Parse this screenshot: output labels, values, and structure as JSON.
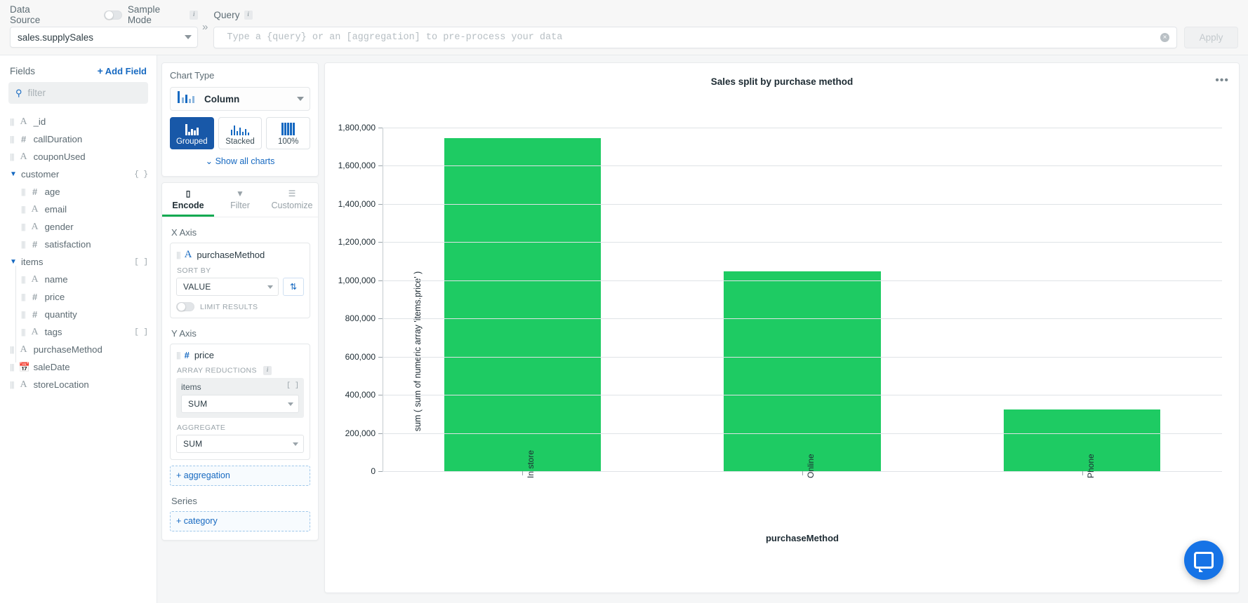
{
  "topbar": {
    "data_source_label": "Data Source",
    "sample_mode_label": "Sample Mode",
    "sample_mode_info": "i",
    "data_source_value": "sales.supplySales",
    "collapse_icon": "»",
    "query_label": "Query",
    "query_info": "i",
    "query_value": "",
    "query_placeholder": "Type a {query} or an [aggregation] to pre-process your data",
    "clear_icon": "×",
    "apply_label": "Apply"
  },
  "fields": {
    "title": "Fields",
    "add_field_label": "Add Field",
    "add_field_plus": "+",
    "filter_placeholder": "filter",
    "items": [
      {
        "label": "_id",
        "type": "string",
        "depth": 0,
        "badge": ""
      },
      {
        "label": "callDuration",
        "type": "number",
        "depth": 0,
        "badge": ""
      },
      {
        "label": "couponUsed",
        "type": "string",
        "depth": 0,
        "badge": ""
      },
      {
        "label": "customer",
        "type": "group",
        "depth": 0,
        "badge": "{ }"
      },
      {
        "label": "age",
        "type": "number",
        "depth": 1,
        "badge": ""
      },
      {
        "label": "email",
        "type": "string",
        "depth": 1,
        "badge": ""
      },
      {
        "label": "gender",
        "type": "string",
        "depth": 1,
        "badge": ""
      },
      {
        "label": "satisfaction",
        "type": "number",
        "depth": 1,
        "badge": ""
      },
      {
        "label": "items",
        "type": "group",
        "depth": 0,
        "badge": "[ ]"
      },
      {
        "label": "name",
        "type": "string",
        "depth": 1,
        "badge": ""
      },
      {
        "label": "price",
        "type": "number",
        "depth": 1,
        "badge": ""
      },
      {
        "label": "quantity",
        "type": "number",
        "depth": 1,
        "badge": ""
      },
      {
        "label": "tags",
        "type": "string",
        "depth": 1,
        "badge": "[ ]"
      },
      {
        "label": "purchaseMethod",
        "type": "string",
        "depth": 0,
        "badge": ""
      },
      {
        "label": "saleDate",
        "type": "date",
        "depth": 0,
        "badge": ""
      },
      {
        "label": "storeLocation",
        "type": "string",
        "depth": 0,
        "badge": ""
      }
    ]
  },
  "chart_type": {
    "title": "Chart Type",
    "selected": "Column",
    "variants": [
      {
        "label": "Grouped",
        "active": true
      },
      {
        "label": "Stacked",
        "active": false
      },
      {
        "label": "100%",
        "active": false
      }
    ],
    "show_all_label": "Show all charts",
    "show_all_chevron": "⌄"
  },
  "encode": {
    "tabs": [
      {
        "label": "Encode",
        "active": true
      },
      {
        "label": "Filter",
        "active": false
      },
      {
        "label": "Customize",
        "active": false
      }
    ],
    "x_axis": {
      "title": "X Axis",
      "field": "purchaseMethod",
      "field_type": "string",
      "sort_by_label": "SORT BY",
      "sort_by_value": "VALUE",
      "sort_direction_icon": "sort-icon",
      "limit_results_label": "LIMIT RESULTS",
      "limit_results_on": false
    },
    "y_axis": {
      "title": "Y Axis",
      "field": "price",
      "field_type": "number",
      "array_reductions_label": "ARRAY REDUCTIONS",
      "array_reductions_info": "i",
      "reduction_field": "items",
      "reduction_value": "SUM",
      "reduction_badge": "[ ]",
      "aggregate_label": "AGGREGATE",
      "aggregate_value": "SUM",
      "add_aggregation_label": "+ aggregation"
    },
    "series": {
      "title": "Series",
      "add_category_label": "+ category"
    }
  },
  "chart_panel": {
    "menu_icon": "•••",
    "chat_icon": "chat-icon"
  },
  "chart_data": {
    "type": "bar",
    "title": "Sales split by purchase method",
    "categories": [
      "In store",
      "Online",
      "Phone"
    ],
    "values": [
      1745000,
      1048000,
      325000
    ],
    "xlabel": "purchaseMethod",
    "ylabel": "sum ( sum of numeric array 'items.price' )",
    "ylim": [
      0,
      1800000
    ],
    "yticks": [
      0,
      200000,
      400000,
      600000,
      800000,
      1000000,
      1200000,
      1400000,
      1600000,
      1800000
    ],
    "ytick_labels": [
      "0",
      "200,000",
      "400,000",
      "600,000",
      "800,000",
      "1,000,000",
      "1,200,000",
      "1,400,000",
      "1,600,000",
      "1,800,000"
    ],
    "bar_color": "#1ecb63",
    "grid": true,
    "legend": "none"
  }
}
